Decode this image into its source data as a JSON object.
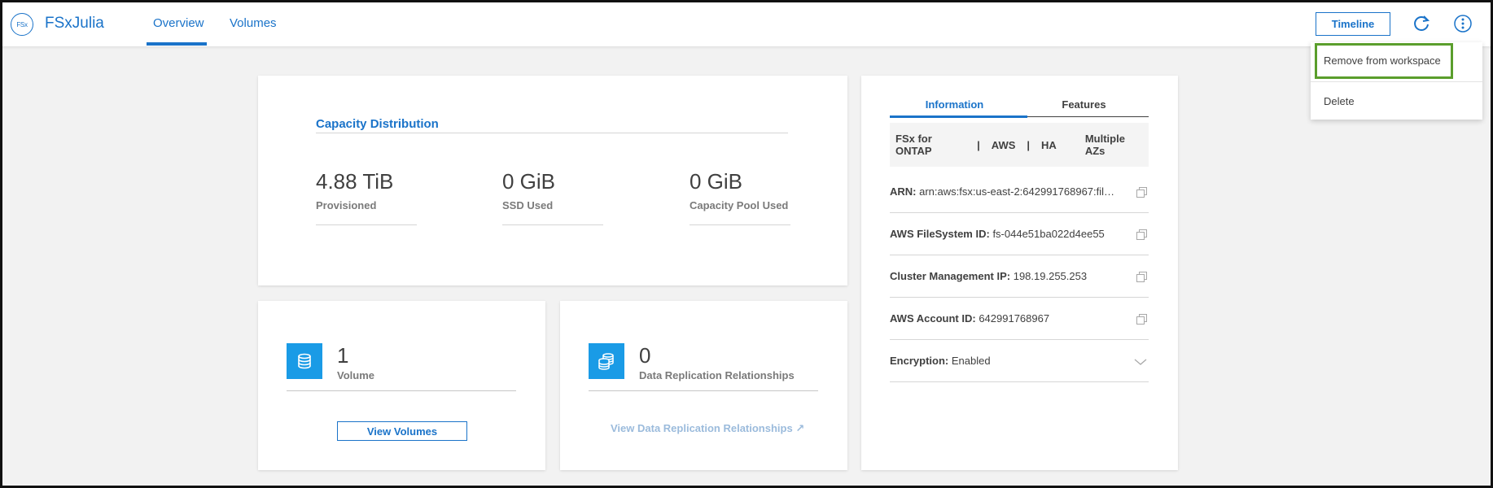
{
  "header": {
    "logo_text": "FSx",
    "title": "FSxJulia",
    "tabs": [
      {
        "label": "Overview",
        "active": true
      },
      {
        "label": "Volumes",
        "active": false
      }
    ],
    "timeline_label": "Timeline",
    "refresh_icon": "refresh-icon",
    "more_icon": "kebab-menu-icon"
  },
  "menu": {
    "items": [
      {
        "label": "Remove from workspace",
        "highlighted": true
      },
      {
        "label": "Delete"
      }
    ],
    "highlight_color": "#5a9e2c"
  },
  "capacity": {
    "title": "Capacity Distribution",
    "metrics": [
      {
        "value": "4.88 TiB",
        "label": "Provisioned"
      },
      {
        "value": "0 GiB",
        "label": "SSD Used"
      },
      {
        "value": "0 GiB",
        "label": "Capacity Pool Used"
      }
    ]
  },
  "volumes_tile": {
    "count": "1",
    "label": "Volume",
    "button_label": "View Volumes",
    "icon": "database-icon"
  },
  "replication_tile": {
    "count": "0",
    "label": "Data Replication Relationships",
    "link_label": "View Data Replication Relationships ↗",
    "icon": "database-stack-icon"
  },
  "info": {
    "tabs": [
      {
        "label": "Information",
        "active": true
      },
      {
        "label": "Features",
        "active": false
      }
    ],
    "summary": [
      "FSx for ONTAP",
      "|",
      "AWS",
      "|",
      "HA",
      "Multiple AZs"
    ],
    "rows": [
      {
        "key": "ARN:",
        "value": "arn:aws:fsx:us-east-2:642991768967:file..."
      },
      {
        "key": "AWS FileSystem ID:",
        "value": "fs-044e51ba022d4ee55"
      },
      {
        "key": "Cluster Management IP:",
        "value": "198.19.255.253"
      },
      {
        "key": "AWS Account ID:",
        "value": "642991768967"
      },
      {
        "key": "Encryption:",
        "value": "Enabled"
      }
    ]
  },
  "colors": {
    "accent": "#1a73c9",
    "tile_icon_bg": "#1a9be6"
  }
}
